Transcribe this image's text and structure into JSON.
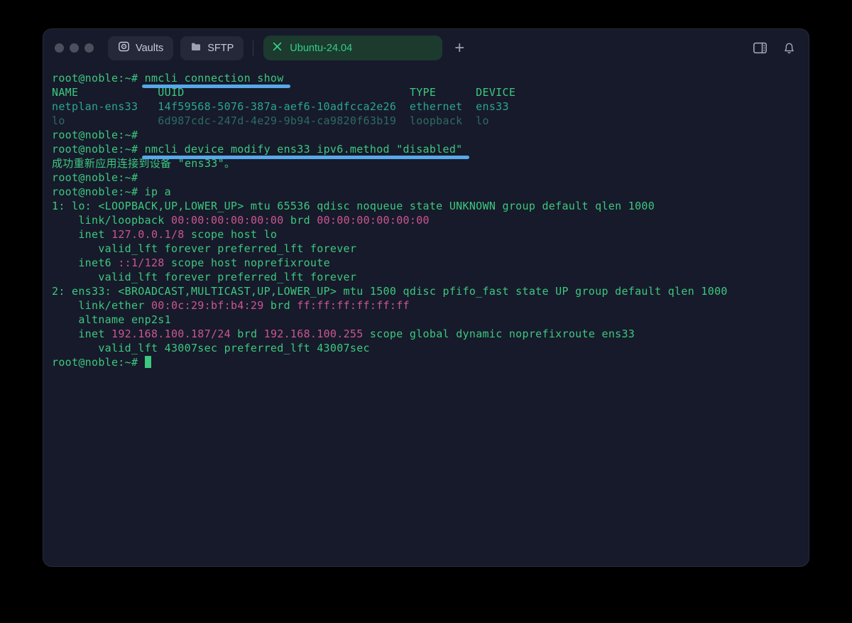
{
  "app": {
    "title": "terminal-ssh-client"
  },
  "colors": {
    "window_bg": "#171a2b",
    "page_bg": "#000000",
    "prompt_green": "#3cc87e",
    "table_teal": "#2aa78d",
    "dimmed_teal": "#2c6b61",
    "value_pink": "#c9578f",
    "command_underline_blue": "#57a9e8",
    "tab_bg_green": "#1d3a2f",
    "tab_text_green": "#30d184",
    "button_bg": "#242839"
  },
  "tabbar": {
    "vaults_label": "Vaults",
    "sftp_label": "SFTP",
    "active_tab_label": "Ubuntu-24.04",
    "new_tab_label": "+"
  },
  "terminal": {
    "lines": [
      {
        "segments": [
          {
            "text": "root@noble:~# ",
            "color": "green"
          },
          {
            "text": "nmcli connection show",
            "color": "cmd"
          }
        ]
      },
      {
        "segments": [
          {
            "text": "NAME            UUID                                  TYPE      DEVICE",
            "color": "green"
          }
        ]
      },
      {
        "segments": [
          {
            "text": "netplan-ens33   14f59568-5076-387a-aef6-10adfcca2e26  ethernet  ens33",
            "color": "teal"
          }
        ]
      },
      {
        "segments": [
          {
            "text": "lo              6d987cdc-247d-4e29-9b94-ca9820f63b19  loopback  lo",
            "color": "dim"
          }
        ]
      },
      {
        "segments": [
          {
            "text": "root@noble:~# ",
            "color": "green"
          }
        ]
      },
      {
        "segments": [
          {
            "text": "root@noble:~# ",
            "color": "green"
          },
          {
            "text": "nmcli device modify ens33 ipv6.method \"disabled\"",
            "color": "cmd"
          }
        ]
      },
      {
        "segments": [
          {
            "text": "成功重新应用连接到设备 \"ens33\"。",
            "color": "green"
          }
        ]
      },
      {
        "segments": [
          {
            "text": "root@noble:~# ",
            "color": "green"
          }
        ]
      },
      {
        "segments": [
          {
            "text": "root@noble:~# ip a",
            "color": "green"
          }
        ]
      },
      {
        "segments": [
          {
            "text": "1: lo: <LOOPBACK,UP,LOWER_UP> mtu 65536 qdisc noqueue state UNKNOWN group default qlen 1000",
            "color": "green"
          }
        ]
      },
      {
        "segments": [
          {
            "text": "    link/loopback ",
            "color": "green"
          },
          {
            "text": "00:00:00:00:00:00",
            "color": "pink"
          },
          {
            "text": " brd ",
            "color": "green"
          },
          {
            "text": "00:00:00:00:00:00",
            "color": "pink"
          }
        ]
      },
      {
        "segments": [
          {
            "text": "    inet ",
            "color": "green"
          },
          {
            "text": "127.0.0.1/8",
            "color": "pink"
          },
          {
            "text": " scope host lo",
            "color": "green"
          }
        ]
      },
      {
        "segments": [
          {
            "text": "       valid_lft forever preferred_lft forever",
            "color": "green"
          }
        ]
      },
      {
        "segments": [
          {
            "text": "    inet6 ",
            "color": "green"
          },
          {
            "text": "::1/128",
            "color": "pink"
          },
          {
            "text": " scope host noprefixroute",
            "color": "green"
          }
        ]
      },
      {
        "segments": [
          {
            "text": "       valid_lft forever preferred_lft forever",
            "color": "green"
          }
        ]
      },
      {
        "segments": [
          {
            "text": "2: ens33: <BROADCAST,MULTICAST,UP,LOWER_UP> mtu 1500 qdisc pfifo_fast state UP group default qlen 1000",
            "color": "green"
          }
        ]
      },
      {
        "segments": [
          {
            "text": "    link/ether ",
            "color": "green"
          },
          {
            "text": "00:0c:29:bf:b4:29",
            "color": "pink"
          },
          {
            "text": " brd ",
            "color": "green"
          },
          {
            "text": "ff:ff:ff:ff:ff:ff",
            "color": "pink"
          }
        ]
      },
      {
        "segments": [
          {
            "text": "    altname enp2s1",
            "color": "green"
          }
        ]
      },
      {
        "segments": [
          {
            "text": "    inet ",
            "color": "green"
          },
          {
            "text": "192.168.100.187/24",
            "color": "pink"
          },
          {
            "text": " brd ",
            "color": "green"
          },
          {
            "text": "192.168.100.255",
            "color": "pink"
          },
          {
            "text": " scope global dynamic noprefixroute ens33",
            "color": "green"
          }
        ]
      },
      {
        "segments": [
          {
            "text": "       valid_lft 43007sec preferred_lft 43007sec",
            "color": "green"
          }
        ]
      },
      {
        "segments": [
          {
            "text": "root@noble:~# ",
            "color": "green"
          }
        ],
        "cursor": true
      }
    ]
  }
}
